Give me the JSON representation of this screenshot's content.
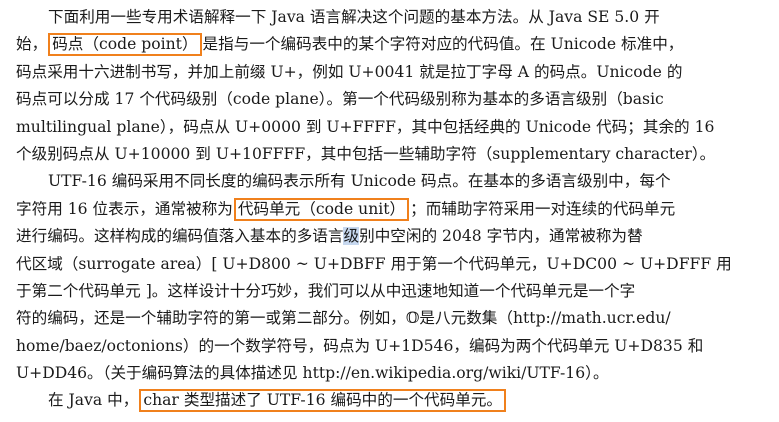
{
  "lines": [
    {
      "parts": [
        "下面利用一些专用术语解释一下 Java 语言解决这个问题的基本方法。从 Java SE 5.0 开"
      ]
    },
    {
      "parts": [
        "始，",
        "码点（code point）",
        "是指与一个编码表中的某个字符对应的代码值。在 Unicode 标准中，"
      ]
    },
    {
      "parts": [
        "码点采用十六进制书写，并加上前缀 U+，例如 U+0041 就是拉丁字母 A 的码点。Unicode 的"
      ]
    },
    {
      "parts": [
        "码点可以分成 17 个代码级别（code plane）。第一个代码级别称为基本的多语言级别（basic"
      ]
    },
    {
      "parts": [
        "multilingual plane），码点从 U+0000 到 U+FFFF，其中包括经典的 Unicode 代码；其余的 16"
      ]
    },
    {
      "parts": [
        "个级别码点从 U+10000 到 U+10FFFF，其中包括一些辅助字符（supplementary character）。"
      ]
    },
    {
      "parts": [
        "UTF-16 编码采用不同长度的编码表示所有 Unicode 码点。在基本的多语言级别中，每个"
      ]
    },
    {
      "parts": [
        "字符用 16 位表示，通常被称为",
        "代码单元（code unit）",
        "；而辅助字符采用一对连续的代码单元"
      ]
    },
    {
      "parts": [
        "进行编码。这样构成的编码值落入基本的多语言",
        "级",
        "别中空闲的 2048 字节内，通常被称为替"
      ]
    },
    {
      "parts": [
        "代区域（surrogate area）[ U+D800 ~ U+DBFF 用于第一个代码单元，U+DC00 ~ U+DFFF 用"
      ]
    },
    {
      "parts": [
        "于第二个代码单元 ]。这样设计十分巧妙，我们可以从中迅速地知道一个代码单元是一个字"
      ]
    },
    {
      "parts": [
        "符的编码，还是一个辅助字符的第一或第二部分。例如，𝕆是八元数集（http://math.ucr.edu/"
      ]
    },
    {
      "parts": [
        "home/baez/octonions）的一个数学符号，码点为 U+1D546，编码为两个代码单元 U+D835 和"
      ]
    },
    {
      "parts": [
        "U+DD46。（关于编码算法的具体描述见 http://en.wikipedia.org/wiki/UTF-16）。"
      ]
    },
    {
      "parts": [
        "在 Java 中，",
        "char 类型描述了 UTF-16 编码中的一个代码单元。"
      ]
    }
  ]
}
